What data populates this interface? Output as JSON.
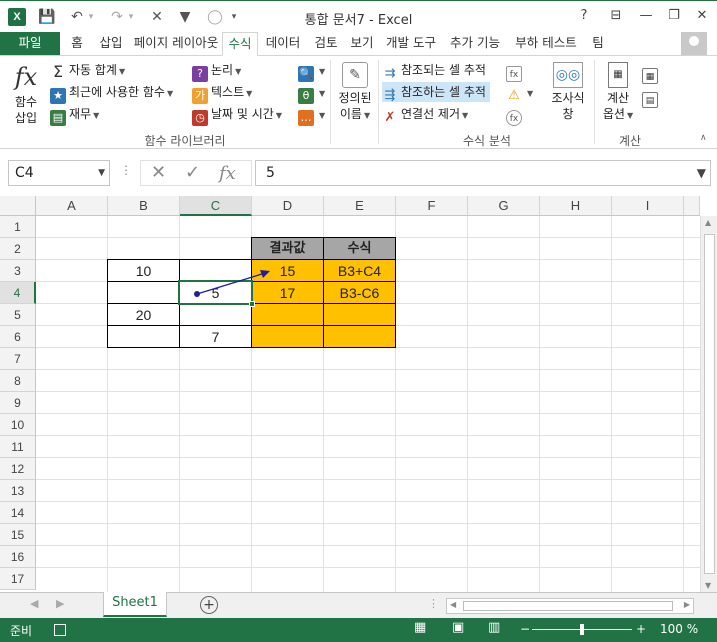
{
  "window": {
    "title": "통합 문서7 - Excel",
    "app_icon": "X",
    "help": "?",
    "minimize": "—",
    "restore": "❐",
    "close": "✕",
    "ribbon_options": "⊟"
  },
  "qat": {
    "save": "💾",
    "undo": "↶",
    "redo": "↷",
    "clear": "✕",
    "filter": "▼",
    "circle": "◯",
    "more": "▾"
  },
  "tabs": [
    "파일",
    "홈",
    "삽입",
    "페이지 레이아웃",
    "수식",
    "데이터",
    "검토",
    "보기",
    "개발 도구",
    "추가 기능",
    "부하 테스트",
    "팀"
  ],
  "ribbon": {
    "function_library": {
      "insert_function": [
        "함수",
        "삽입"
      ],
      "autosum": "자동 합계",
      "recent": "최근에 사용한 함수",
      "financial": "재무",
      "logical": "논리",
      "text": "텍스트",
      "datetime": "날짜 및 시간",
      "group_label": "함수 라이브러리"
    },
    "defined_names": [
      "정의된",
      "이름"
    ],
    "formula_auditing": {
      "trace_precedents": "참조되는 셀 추적",
      "trace_dependents": "참조하는 셀 추적",
      "remove_arrows": "연결선 제거",
      "group_label": "수식 분석"
    },
    "watch_window": [
      "조사식",
      "창"
    ],
    "calculation": {
      "options": [
        "계산",
        "옵션"
      ],
      "group_label": "계산"
    }
  },
  "formula_bar": {
    "name_box": "C4",
    "formula": "5",
    "fx": "fx"
  },
  "columns": [
    "A",
    "B",
    "C",
    "D",
    "E",
    "F",
    "G",
    "H",
    "I"
  ],
  "rows": [
    "1",
    "2",
    "3",
    "4",
    "5",
    "6",
    "7",
    "8",
    "9",
    "10",
    "11",
    "12",
    "13",
    "14",
    "15",
    "16",
    "17"
  ],
  "cells": {
    "D2": "결과값",
    "E2": "수식",
    "B3": "10",
    "D3": "15",
    "E3": "B3+C4",
    "C4": "5",
    "D4": "17",
    "E4": "B3-C6",
    "B5": "20",
    "C6": "7"
  },
  "active_cell": "C4",
  "sheet_tabs": [
    "Sheet1"
  ],
  "status": {
    "mode": "준비",
    "zoom": "100 %"
  },
  "colors": {
    "accent": "#217346",
    "orange": "#ffc000",
    "header_gray": "#a6a6a6",
    "arrow": "#1f1fa0"
  }
}
